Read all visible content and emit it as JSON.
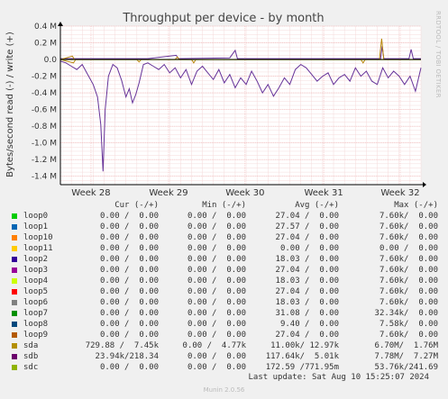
{
  "chart_data": {
    "type": "line",
    "title": "Throughput per device - by month",
    "ylabel": "Bytes/second read (-) / write (+)",
    "side_label": "RRDTOOL / TOBI OETIKER",
    "ylim": [
      -1.5,
      0.4
    ],
    "yticks": [
      {
        "v": 0.4,
        "label": "0.4 M"
      },
      {
        "v": 0.2,
        "label": "0.2 M"
      },
      {
        "v": 0.0,
        "label": "0.0"
      },
      {
        "v": -0.2,
        "label": "-0.2 M"
      },
      {
        "v": -0.4,
        "label": "-0.4 M"
      },
      {
        "v": -0.6,
        "label": "-0.6 M"
      },
      {
        "v": -0.8,
        "label": "-0.8 M"
      },
      {
        "v": -1.0,
        "label": "-1.0 M"
      },
      {
        "v": -1.2,
        "label": "-1.2 M"
      },
      {
        "v": -1.4,
        "label": "-1.4 M"
      }
    ],
    "xlim": [
      0,
      33
    ],
    "xticks": [
      {
        "v": 2.8,
        "label": "Week 28"
      },
      {
        "v": 9.9,
        "label": "Week 29"
      },
      {
        "v": 16.9,
        "label": "Week 30"
      },
      {
        "v": 24.1,
        "label": "Week 31"
      },
      {
        "v": 31.1,
        "label": "Week 32"
      }
    ],
    "series": [
      {
        "name": "sdb",
        "color": "#663399",
        "read": [
          [
            0.0,
            -0.02
          ],
          [
            0.5,
            -0.04
          ],
          [
            1.0,
            -0.08
          ],
          [
            1.5,
            -0.12
          ],
          [
            2.0,
            -0.06
          ],
          [
            2.5,
            -0.18
          ],
          [
            3.0,
            -0.3
          ],
          [
            3.4,
            -0.45
          ],
          [
            3.7,
            -0.78
          ],
          [
            3.9,
            -1.34
          ],
          [
            4.1,
            -0.6
          ],
          [
            4.4,
            -0.2
          ],
          [
            4.8,
            -0.06
          ],
          [
            5.2,
            -0.1
          ],
          [
            5.6,
            -0.25
          ],
          [
            6.0,
            -0.45
          ],
          [
            6.3,
            -0.35
          ],
          [
            6.6,
            -0.52
          ],
          [
            6.9,
            -0.42
          ],
          [
            7.2,
            -0.28
          ],
          [
            7.6,
            -0.06
          ],
          [
            8.0,
            -0.04
          ],
          [
            8.5,
            -0.08
          ],
          [
            9.0,
            -0.12
          ],
          [
            9.5,
            -0.06
          ],
          [
            10.0,
            -0.16
          ],
          [
            10.5,
            -0.1
          ],
          [
            11.0,
            -0.22
          ],
          [
            11.5,
            -0.12
          ],
          [
            12.0,
            -0.3
          ],
          [
            12.5,
            -0.14
          ],
          [
            13.0,
            -0.08
          ],
          [
            13.5,
            -0.16
          ],
          [
            14.0,
            -0.24
          ],
          [
            14.5,
            -0.12
          ],
          [
            15.0,
            -0.28
          ],
          [
            15.5,
            -0.18
          ],
          [
            16.0,
            -0.34
          ],
          [
            16.5,
            -0.22
          ],
          [
            17.0,
            -0.3
          ],
          [
            17.5,
            -0.14
          ],
          [
            18.0,
            -0.26
          ],
          [
            18.5,
            -0.4
          ],
          [
            19.0,
            -0.3
          ],
          [
            19.5,
            -0.44
          ],
          [
            20.0,
            -0.34
          ],
          [
            20.5,
            -0.22
          ],
          [
            21.0,
            -0.3
          ],
          [
            21.5,
            -0.12
          ],
          [
            22.0,
            -0.06
          ],
          [
            22.5,
            -0.1
          ],
          [
            23.0,
            -0.18
          ],
          [
            23.5,
            -0.26
          ],
          [
            24.0,
            -0.2
          ],
          [
            24.5,
            -0.16
          ],
          [
            25.0,
            -0.3
          ],
          [
            25.5,
            -0.22
          ],
          [
            26.0,
            -0.18
          ],
          [
            26.5,
            -0.26
          ],
          [
            27.0,
            -0.1
          ],
          [
            27.5,
            -0.2
          ],
          [
            28.0,
            -0.14
          ],
          [
            28.5,
            -0.26
          ],
          [
            29.0,
            -0.3
          ],
          [
            29.5,
            -0.1
          ],
          [
            30.0,
            -0.22
          ],
          [
            30.5,
            -0.14
          ],
          [
            31.0,
            -0.2
          ],
          [
            31.5,
            -0.3
          ],
          [
            32.0,
            -0.2
          ],
          [
            32.5,
            -0.38
          ],
          [
            33.0,
            -0.1
          ]
        ],
        "write": [
          [
            0.0,
            0.01
          ],
          [
            8.0,
            0.01
          ],
          [
            10.6,
            0.05
          ],
          [
            10.8,
            0.01
          ],
          [
            15.5,
            0.02
          ],
          [
            16.0,
            0.11
          ],
          [
            16.2,
            0.01
          ],
          [
            29.3,
            0.01
          ],
          [
            29.45,
            0.16
          ],
          [
            29.6,
            0.01
          ],
          [
            31.9,
            0.01
          ],
          [
            32.1,
            0.12
          ],
          [
            32.3,
            0.01
          ],
          [
            33.0,
            0.01
          ]
        ]
      },
      {
        "name": "sda",
        "color": "#B8860B",
        "read": [
          [
            0.0,
            0.0
          ],
          [
            1.2,
            -0.04
          ],
          [
            1.4,
            0.0
          ],
          [
            7.0,
            0.0
          ],
          [
            7.2,
            -0.03
          ],
          [
            7.4,
            0.0
          ],
          [
            12.0,
            0.0
          ],
          [
            12.2,
            -0.04
          ],
          [
            12.4,
            0.0
          ],
          [
            27.5,
            0.0
          ],
          [
            27.7,
            -0.04
          ],
          [
            27.9,
            0.0
          ],
          [
            33.0,
            0.0
          ]
        ],
        "write": [
          [
            0.0,
            0.0
          ],
          [
            1.1,
            0.04
          ],
          [
            1.3,
            0.0
          ],
          [
            10.5,
            0.0
          ],
          [
            10.7,
            0.03
          ],
          [
            10.9,
            0.0
          ],
          [
            29.2,
            0.0
          ],
          [
            29.4,
            0.25
          ],
          [
            29.6,
            0.0
          ],
          [
            33.0,
            0.0
          ]
        ]
      },
      {
        "name": "sdc",
        "color": "#9ACD32",
        "read": [
          [
            0.0,
            0.0
          ],
          [
            33.0,
            0.0
          ]
        ],
        "write": [
          [
            0.0,
            0.0
          ],
          [
            33.0,
            0.0
          ]
        ]
      }
    ]
  },
  "legend": {
    "headers": {
      "cur": "Cur (-/+)",
      "min": "Min (-/+)",
      "avg": "Avg (-/+)",
      "max": "Max (-/+)"
    },
    "rows": [
      {
        "name": "loop0",
        "color": "#00CC00",
        "cur": "0.00 /  0.00",
        "min": "0.00 /  0.00",
        "avg": "27.04 /  0.00",
        "max": "7.60k/  0.00"
      },
      {
        "name": "loop1",
        "color": "#0066B3",
        "cur": "0.00 /  0.00",
        "min": "0.00 /  0.00",
        "avg": "27.57 /  0.00",
        "max": "7.60k/  0.00"
      },
      {
        "name": "loop10",
        "color": "#FF8000",
        "cur": "0.00 /  0.00",
        "min": "0.00 /  0.00",
        "avg": "27.04 /  0.00",
        "max": "7.60k/  0.00"
      },
      {
        "name": "loop11",
        "color": "#FFCC00",
        "cur": "0.00 /  0.00",
        "min": "0.00 /  0.00",
        "avg": "0.00 /  0.00",
        "max": "0.00 /  0.00"
      },
      {
        "name": "loop2",
        "color": "#330099",
        "cur": "0.00 /  0.00",
        "min": "0.00 /  0.00",
        "avg": "18.03 /  0.00",
        "max": "7.60k/  0.00"
      },
      {
        "name": "loop3",
        "color": "#990099",
        "cur": "0.00 /  0.00",
        "min": "0.00 /  0.00",
        "avg": "27.04 /  0.00",
        "max": "7.60k/  0.00"
      },
      {
        "name": "loop4",
        "color": "#CCFF00",
        "cur": "0.00 /  0.00",
        "min": "0.00 /  0.00",
        "avg": "18.03 /  0.00",
        "max": "7.60k/  0.00"
      },
      {
        "name": "loop5",
        "color": "#FF0000",
        "cur": "0.00 /  0.00",
        "min": "0.00 /  0.00",
        "avg": "27.04 /  0.00",
        "max": "7.60k/  0.00"
      },
      {
        "name": "loop6",
        "color": "#808080",
        "cur": "0.00 /  0.00",
        "min": "0.00 /  0.00",
        "avg": "18.03 /  0.00",
        "max": "7.60k/  0.00"
      },
      {
        "name": "loop7",
        "color": "#008F00",
        "cur": "0.00 /  0.00",
        "min": "0.00 /  0.00",
        "avg": "31.08 /  0.00",
        "max": "32.34k/  0.00"
      },
      {
        "name": "loop8",
        "color": "#00487D",
        "cur": "0.00 /  0.00",
        "min": "0.00 /  0.00",
        "avg": "9.40 /  0.00",
        "max": "7.58k/  0.00"
      },
      {
        "name": "loop9",
        "color": "#B35A00",
        "cur": "0.00 /  0.00",
        "min": "0.00 /  0.00",
        "avg": "27.04 /  0.00",
        "max": "7.60k/  0.00"
      },
      {
        "name": "sda",
        "color": "#B38F00",
        "cur": "729.88 /  7.45k",
        "min": "0.00 /  4.77k",
        "avg": "11.00k/ 12.97k",
        "max": "6.70M/  1.76M"
      },
      {
        "name": "sdb",
        "color": "#6B006B",
        "cur": "23.94k/218.34",
        "min": "0.00 /  0.00",
        "avg": "117.64k/  5.01k",
        "max": "7.78M/  7.27M"
      },
      {
        "name": "sdc",
        "color": "#8FB300",
        "cur": "0.00 /  0.00",
        "min": "0.00 /  0.00",
        "avg": "172.59 /771.95m",
        "max": "53.76k/241.69"
      }
    ]
  },
  "last_update": "Last update: Sat Aug 10 15:25:07 2024",
  "munin_version": "Munin 2.0.56"
}
